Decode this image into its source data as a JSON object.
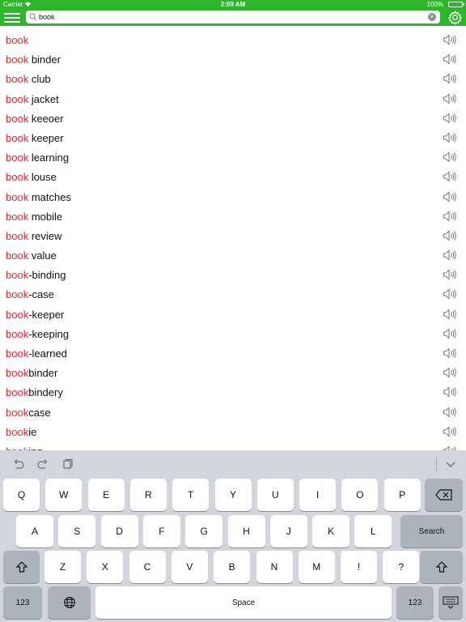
{
  "status_bar": {
    "carrier": "Carrier",
    "time": "2:09 AM",
    "battery": "100%"
  },
  "search": {
    "value": "book",
    "placeholder": ""
  },
  "icons": {
    "menu": "hamburger-icon",
    "search": "magnifier-icon",
    "clear": "clear-icon",
    "settings": "gear-icon",
    "speaker": "speaker-icon"
  },
  "colors": {
    "bar": "#2fb52c",
    "highlight": "#e5242b"
  },
  "results": [
    {
      "match": "book",
      "rest": ""
    },
    {
      "match": "book",
      "rest": " binder"
    },
    {
      "match": "book",
      "rest": " club"
    },
    {
      "match": "book",
      "rest": " jacket"
    },
    {
      "match": "book",
      "rest": " keeoer"
    },
    {
      "match": "book",
      "rest": " keeper"
    },
    {
      "match": "book",
      "rest": " learning"
    },
    {
      "match": "book",
      "rest": " louse"
    },
    {
      "match": "book",
      "rest": " matches"
    },
    {
      "match": "book",
      "rest": " mobile"
    },
    {
      "match": "book",
      "rest": " review"
    },
    {
      "match": "book",
      "rest": " value"
    },
    {
      "match": "book",
      "rest": "-binding"
    },
    {
      "match": "book",
      "rest": "-case"
    },
    {
      "match": "book",
      "rest": "-keeper"
    },
    {
      "match": "book",
      "rest": "-keeping"
    },
    {
      "match": "book",
      "rest": "-learned"
    },
    {
      "match": "book",
      "rest": "binder"
    },
    {
      "match": "book",
      "rest": "bindery"
    },
    {
      "match": "book",
      "rest": "case"
    },
    {
      "match": "book",
      "rest": "ie"
    },
    {
      "match": "book",
      "rest": "ing"
    }
  ],
  "keyboard": {
    "row1": [
      "Q",
      "W",
      "E",
      "R",
      "T",
      "Y",
      "U",
      "I",
      "O",
      "P"
    ],
    "row2": [
      "A",
      "S",
      "D",
      "F",
      "G",
      "H",
      "J",
      "K",
      "L"
    ],
    "row3": [
      "Z",
      "X",
      "C",
      "V",
      "B",
      "N",
      "M",
      "!",
      "?"
    ],
    "search_label": "Search",
    "numbers_label": "123",
    "space_label": "Space"
  }
}
